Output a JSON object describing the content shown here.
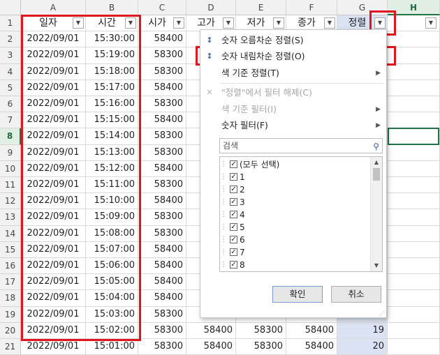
{
  "columns": [
    "A",
    "B",
    "C",
    "D",
    "E",
    "F",
    "G",
    "H"
  ],
  "active_column": "H",
  "active_row": 8,
  "headers": [
    "일자",
    "시간",
    "시가",
    "고가",
    "저가",
    "종가",
    "정렬"
  ],
  "rows": [
    {
      "n": "1"
    },
    {
      "n": "2",
      "date": "2022/09/01",
      "time": "15:30:00",
      "open": "58400"
    },
    {
      "n": "3",
      "date": "2022/09/01",
      "time": "15:19:00",
      "open": "58300"
    },
    {
      "n": "4",
      "date": "2022/09/01",
      "time": "15:18:00",
      "open": "58300"
    },
    {
      "n": "5",
      "date": "2022/09/01",
      "time": "15:17:00",
      "open": "58400"
    },
    {
      "n": "6",
      "date": "2022/09/01",
      "time": "15:16:00",
      "open": "58300"
    },
    {
      "n": "7",
      "date": "2022/09/01",
      "time": "15:15:00",
      "open": "58400"
    },
    {
      "n": "8",
      "date": "2022/09/01",
      "time": "15:14:00",
      "open": "58300"
    },
    {
      "n": "9",
      "date": "2022/09/01",
      "time": "15:13:00",
      "open": "58300"
    },
    {
      "n": "10",
      "date": "2022/09/01",
      "time": "15:12:00",
      "open": "58400"
    },
    {
      "n": "11",
      "date": "2022/09/01",
      "time": "15:11:00",
      "open": "58300"
    },
    {
      "n": "12",
      "date": "2022/09/01",
      "time": "15:10:00",
      "open": "58400"
    },
    {
      "n": "13",
      "date": "2022/09/01",
      "time": "15:09:00",
      "open": "58300"
    },
    {
      "n": "14",
      "date": "2022/09/01",
      "time": "15:08:00",
      "open": "58300"
    },
    {
      "n": "15",
      "date": "2022/09/01",
      "time": "15:07:00",
      "open": "58400"
    },
    {
      "n": "16",
      "date": "2022/09/01",
      "time": "15:06:00",
      "open": "58400"
    },
    {
      "n": "17",
      "date": "2022/09/01",
      "time": "15:05:00",
      "open": "58400"
    },
    {
      "n": "18",
      "date": "2022/09/01",
      "time": "15:04:00",
      "open": "58400"
    },
    {
      "n": "19",
      "date": "2022/09/01",
      "time": "15:03:00",
      "open": "58300"
    },
    {
      "n": "20",
      "date": "2022/09/01",
      "time": "15:02:00",
      "open": "58300",
      "high": "58400",
      "low": "58300",
      "close": "58400",
      "g": "19"
    },
    {
      "n": "21",
      "date": "2022/09/01",
      "time": "15:01:00",
      "open": "58300",
      "high": "58400",
      "low": "58300",
      "close": "58400",
      "g": "20"
    }
  ],
  "menu": {
    "sort_asc": "숫자 오름차순 정렬(S)",
    "sort_desc": "숫자 내림차순 정렬(O)",
    "sort_color": "색 기준 정렬(T)",
    "clear_filter": "\"정렬\"에서 필터 해제(C)",
    "filter_color": "색 기준 필터(I)",
    "number_filter": "숫자 필터(F)",
    "search_placeholder": "검색",
    "select_all": "(모두 선택)",
    "items": [
      "1",
      "2",
      "3",
      "4",
      "5",
      "6",
      "7",
      "8"
    ],
    "ok": "확인",
    "cancel": "취소"
  },
  "icons": {
    "sort_asc": "sort-ascending-icon",
    "sort_desc": "sort-descending-icon",
    "clear_filter": "clear-filter-icon",
    "search": "search-icon"
  },
  "colors": {
    "highlight": "#e0161f",
    "selection": "#217346",
    "g_column_fill": "#dae3f3"
  }
}
